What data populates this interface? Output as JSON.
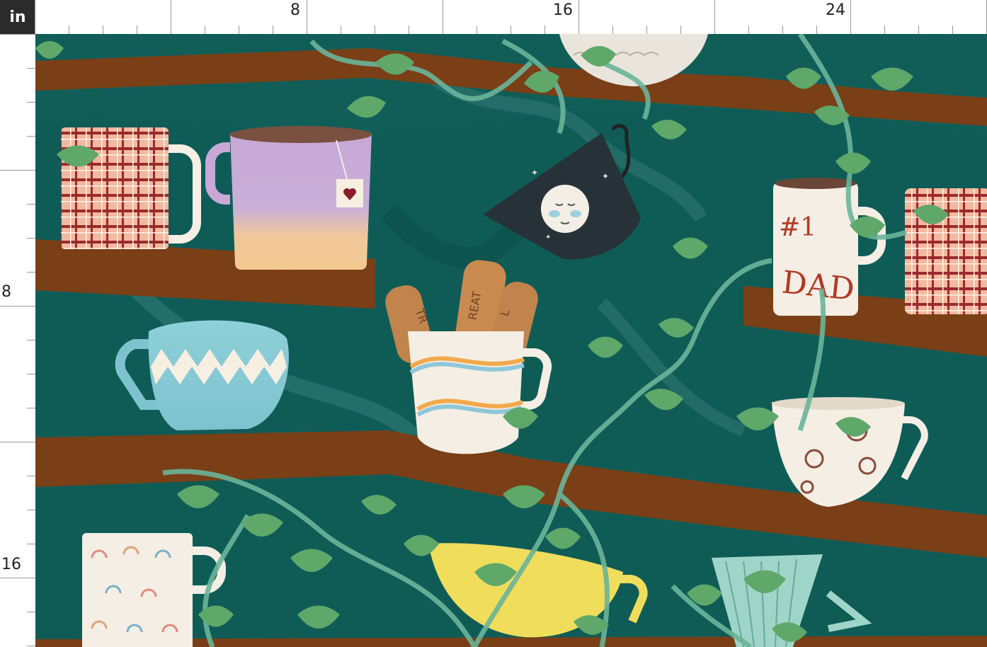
{
  "ruler": {
    "unit": "in",
    "horizontal_labels": [
      "8",
      "16",
      "24"
    ],
    "vertical_labels": [
      "8",
      "16"
    ]
  },
  "pattern": {
    "mug_texts": {
      "dad_mug_line1": "#1",
      "dad_mug_line2": "DAD",
      "treat_bone_left": "TR",
      "treat_bone_center": "REAT",
      "treat_bone_right": "L"
    }
  },
  "colors": {
    "teal_wall": "#0f5c57",
    "shelf_brown": "#7a3f17",
    "leaf_green": "#5fa86a",
    "vine_green": "#6ab59a"
  }
}
